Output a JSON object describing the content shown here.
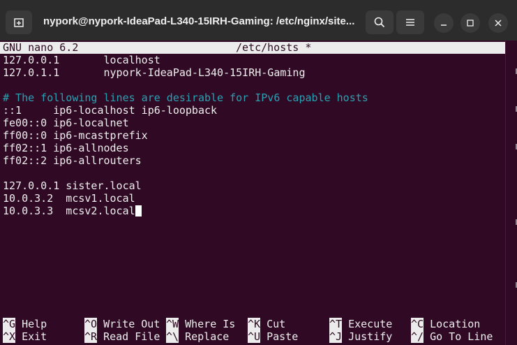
{
  "window": {
    "title": "nypork@nypork-IdeaPad-L340-15IRH-Gaming: /etc/nginx/site...",
    "icons": {
      "new_tab": "new-tab-icon",
      "search": "search-icon",
      "menu": "hamburger-menu-icon",
      "minimize": "minimize-icon",
      "maximize": "maximize-icon",
      "close": "close-icon"
    }
  },
  "nano": {
    "version": "GNU nano 6.2",
    "filename": "/etc/hosts *"
  },
  "buffer": {
    "lines": [
      "127.0.0.1       localhost",
      "127.0.1.1       nypork-IdeaPad-L340-15IRH-Gaming",
      "",
      "# The following lines are desirable for IPv6 capable hosts",
      "::1     ip6-localhost ip6-loopback",
      "fe00::0 ip6-localnet",
      "ff00::0 ip6-mcastprefix",
      "ff02::1 ip6-allnodes",
      "ff02::2 ip6-allrouters",
      "",
      "127.0.0.1 sister.local",
      "10.0.3.2  mcsv1.local",
      "10.0.3.3  mcsv2.local"
    ]
  },
  "shortcuts": {
    "row1": [
      {
        "key": "^G",
        "label": "Help"
      },
      {
        "key": "^O",
        "label": "Write Out"
      },
      {
        "key": "^W",
        "label": "Where Is"
      },
      {
        "key": "^K",
        "label": "Cut"
      },
      {
        "key": "^T",
        "label": "Execute"
      },
      {
        "key": "^C",
        "label": "Location"
      }
    ],
    "row2": [
      {
        "key": "^X",
        "label": "Exit"
      },
      {
        "key": "^R",
        "label": "Read File"
      },
      {
        "key": "^\\",
        "label": "Replace"
      },
      {
        "key": "^U",
        "label": "Paste"
      },
      {
        "key": "^J",
        "label": "Justify"
      },
      {
        "key": "^/",
        "label": "Go To Line"
      }
    ]
  },
  "colors": {
    "terminal_bg": "#300a24",
    "titlebar_bg": "#2c2c2c",
    "comment": "#2aa1b3",
    "text": "#eeeeee",
    "inverse_bg": "#ececec"
  }
}
